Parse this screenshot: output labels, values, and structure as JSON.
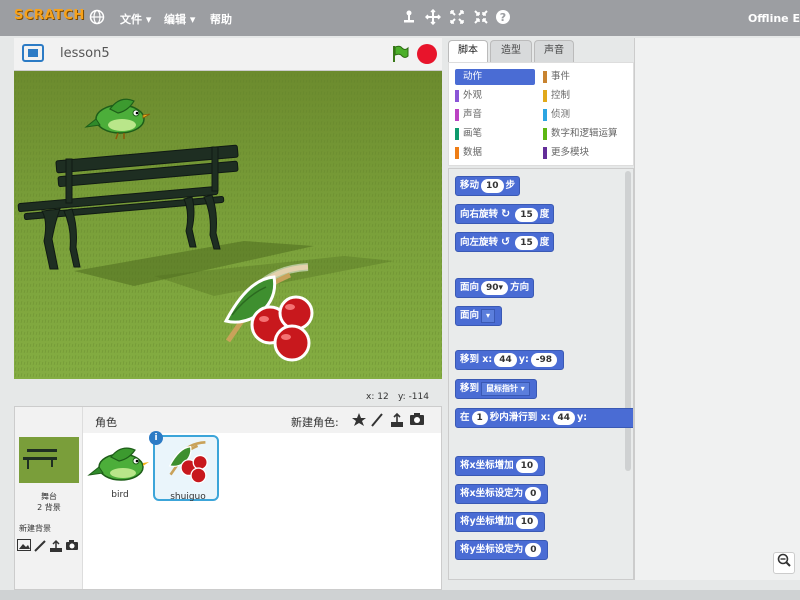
{
  "menubar": {
    "logo": "SCRATCH",
    "menus": [
      "文件 ▾",
      "编辑 ▾",
      "帮助"
    ],
    "tool_icons": [
      "copy-icon",
      "cut-icon",
      "grow-icon",
      "shrink-icon",
      "help-icon"
    ],
    "offline_label": "Offline E"
  },
  "stage": {
    "project_title": "lesson5",
    "mouse_x_label": "x: 12",
    "mouse_y_label": "y: -114"
  },
  "sprites": {
    "header_label": "角色",
    "new_sprite_label": "新建角色:",
    "stage_label": "舞台",
    "stage_backdrops": "2 背景",
    "new_backdrop_label": "新建背景",
    "items": [
      {
        "name": "bird",
        "selected": false
      },
      {
        "name": "shuiguo",
        "selected": true
      }
    ]
  },
  "tabs": [
    "脚本",
    "造型",
    "声音"
  ],
  "categories": [
    {
      "label": "动作",
      "color": "#4a6cd4",
      "active": true
    },
    {
      "label": "外观",
      "color": "#8a55d7",
      "active": false
    },
    {
      "label": "声音",
      "color": "#bb42c3",
      "active": false
    },
    {
      "label": "画笔",
      "color": "#0e9a6c",
      "active": false
    },
    {
      "label": "数据",
      "color": "#ee7d16",
      "active": false
    },
    {
      "label": "事件",
      "color": "#c88330",
      "active": false
    },
    {
      "label": "控制",
      "color": "#e1a91a",
      "active": false
    },
    {
      "label": "侦测",
      "color": "#2ca5e2",
      "active": false
    },
    {
      "label": "数字和逻辑运算",
      "color": "#5cb712",
      "active": false
    },
    {
      "label": "更多模块",
      "color": "#632d99",
      "active": false
    }
  ],
  "blocks": {
    "move_pre": "移动",
    "move_val": "10",
    "move_post": "步",
    "turn_right_pre": "向右旋转",
    "turn_right_val": "15",
    "turn_right_post": "度",
    "turn_left_pre": "向左旋转",
    "turn_left_val": "15",
    "turn_left_post": "度",
    "point_dir_pre": "面向",
    "point_dir_val": "90▾",
    "point_dir_post": "方向",
    "point_towards": "面向",
    "goto_xy_pre": "移到 x:",
    "goto_xy_x": "44",
    "goto_xy_mid": "y:",
    "goto_xy_y": "-98",
    "goto_pre": "移到",
    "goto_dd": "鼠标指针 ▾",
    "glide_pre": "在",
    "glide_val": "1",
    "glide_mid": "秒内滑行到 x:",
    "glide_x": "44",
    "glide_y_label": "y:",
    "change_x_pre": "将x坐标增加",
    "change_x_val": "10",
    "set_x_pre": "将x坐标设定为",
    "set_x_val": "0",
    "change_y_pre": "将y坐标增加",
    "change_y_val": "10",
    "set_y_pre": "将y坐标设定为",
    "set_y_val": "0"
  }
}
